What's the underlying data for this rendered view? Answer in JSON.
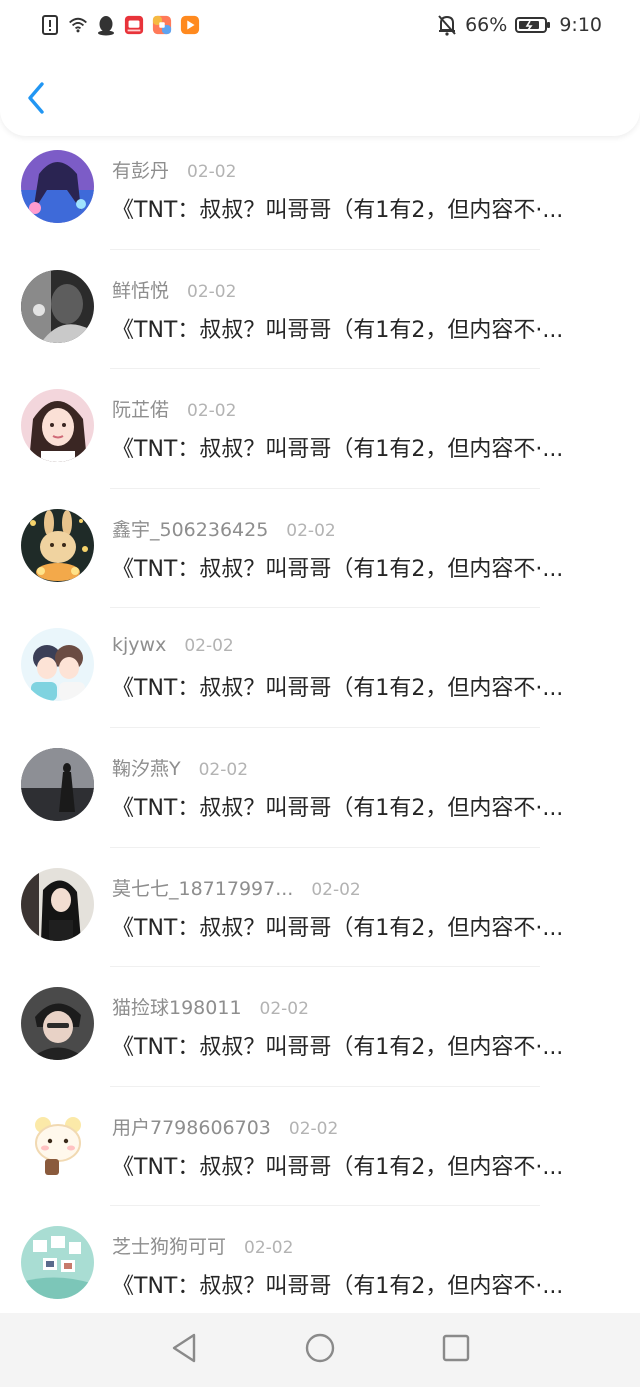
{
  "status_bar": {
    "battery_percent": "66%",
    "time": "9:10",
    "left_icons": [
      "alert-icon",
      "wifi-icon",
      "qq-icon",
      "app-icon-red",
      "app-icon-colorful",
      "app-icon-orange"
    ],
    "right_icons": [
      "mute-bell-icon",
      "battery-icon"
    ]
  },
  "header": {
    "back_icon": "chevron-left-icon",
    "accent_color": "#2196f3"
  },
  "items": [
    {
      "username": "有彭丹",
      "date": "02-02",
      "content": "《TNT：叔叔？叫哥哥（有1有2，但内容不·...",
      "avatar_icon": "avatar-anime-girl"
    },
    {
      "username": "鲜恬悦",
      "date": "02-02",
      "content": "《TNT：叔叔？叫哥哥（有1有2，但内容不·...",
      "avatar_icon": "avatar-mono-portrait"
    },
    {
      "username": "阮芷偌",
      "date": "02-02",
      "content": "《TNT：叔叔？叫哥哥（有1有2，但内容不·...",
      "avatar_icon": "avatar-girl-portrait"
    },
    {
      "username": "鑫宇_506236425",
      "date": "02-02",
      "content": "《TNT：叔叔？叫哥哥（有1有2，但内容不·...",
      "avatar_icon": "avatar-bunny-figure"
    },
    {
      "username": "kjywx",
      "date": "02-02",
      "content": "《TNT：叔叔？叫哥哥（有1有2，但内容不·...",
      "avatar_icon": "avatar-couple-cartoon"
    },
    {
      "username": "鞠汐燕Y",
      "date": "02-02",
      "content": "《TNT：叔叔？叫哥哥（有1有2，但内容不·...",
      "avatar_icon": "avatar-silhouette-sea"
    },
    {
      "username": "莫七七_18717997...",
      "date": "02-02",
      "content": "《TNT：叔叔？叫哥哥（有1有2，但内容不·...",
      "avatar_icon": "avatar-dark-girl"
    },
    {
      "username": "猫捡球198011",
      "date": "02-02",
      "content": "《TNT：叔叔？叫哥哥（有1有2，但内容不·...",
      "avatar_icon": "avatar-boy-portrait"
    },
    {
      "username": "用户7798606703",
      "date": "02-02",
      "content": "《TNT：叔叔？叫哥哥（有1有2，但内容不·...",
      "avatar_icon": "avatar-cute-sheep"
    },
    {
      "username": "芝士狗狗可可",
      "date": "02-02",
      "content": "《TNT：叔叔？叫哥哥（有1有2，但内容不·...",
      "avatar_icon": "avatar-collage"
    }
  ],
  "nav_bar": {
    "back_icon": "nav-back-triangle-icon",
    "home_icon": "nav-home-circle-icon",
    "recents_icon": "nav-recents-square-icon"
  }
}
